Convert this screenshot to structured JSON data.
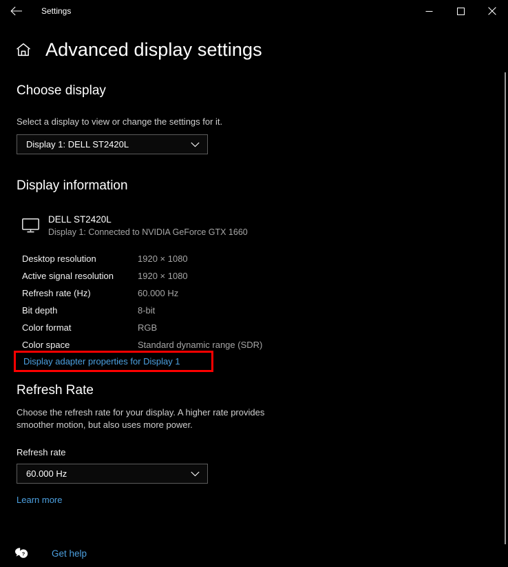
{
  "window": {
    "app_title": "Settings",
    "back_icon": "back-arrow-icon",
    "minimize_label": "Minimize",
    "maximize_label": "Maximize",
    "close_label": "Close"
  },
  "header": {
    "home_icon": "home-icon",
    "title": "Advanced display settings"
  },
  "choose_display": {
    "section_title": "Choose display",
    "description": "Select a display to view or change the settings for it.",
    "dropdown_value": "Display 1: DELL ST2420L",
    "dropdown_icon": "chevron-down-icon"
  },
  "display_information": {
    "section_title": "Display information",
    "monitor_icon": "monitor-icon",
    "monitor_name": "DELL ST2420L",
    "monitor_connection": "Display 1: Connected to NVIDIA GeForce GTX 1660",
    "rows": [
      {
        "label": "Desktop resolution",
        "value": "1920 × 1080"
      },
      {
        "label": "Active signal resolution",
        "value": "1920 × 1080"
      },
      {
        "label": "Refresh rate (Hz)",
        "value": "60.000 Hz"
      },
      {
        "label": "Bit depth",
        "value": "8-bit"
      },
      {
        "label": "Color format",
        "value": "RGB"
      },
      {
        "label": "Color space",
        "value": "Standard dynamic range (SDR)"
      }
    ],
    "adapter_link": "Display adapter properties for Display 1"
  },
  "refresh_rate": {
    "section_title": "Refresh Rate",
    "description": "Choose the refresh rate for your display. A higher rate provides smoother motion, but also uses more power.",
    "field_label": "Refresh rate",
    "dropdown_value": "60.000 Hz",
    "dropdown_icon": "chevron-down-icon",
    "learn_more": "Learn more"
  },
  "footer": {
    "help_icon": "question-bubble-icon",
    "get_help": "Get help"
  },
  "colors": {
    "background": "#000000",
    "link": "#4ca0e0",
    "highlight_box": "#fe0000",
    "secondary_text": "#a6a6a6",
    "control_border": "#5c5c5c"
  }
}
